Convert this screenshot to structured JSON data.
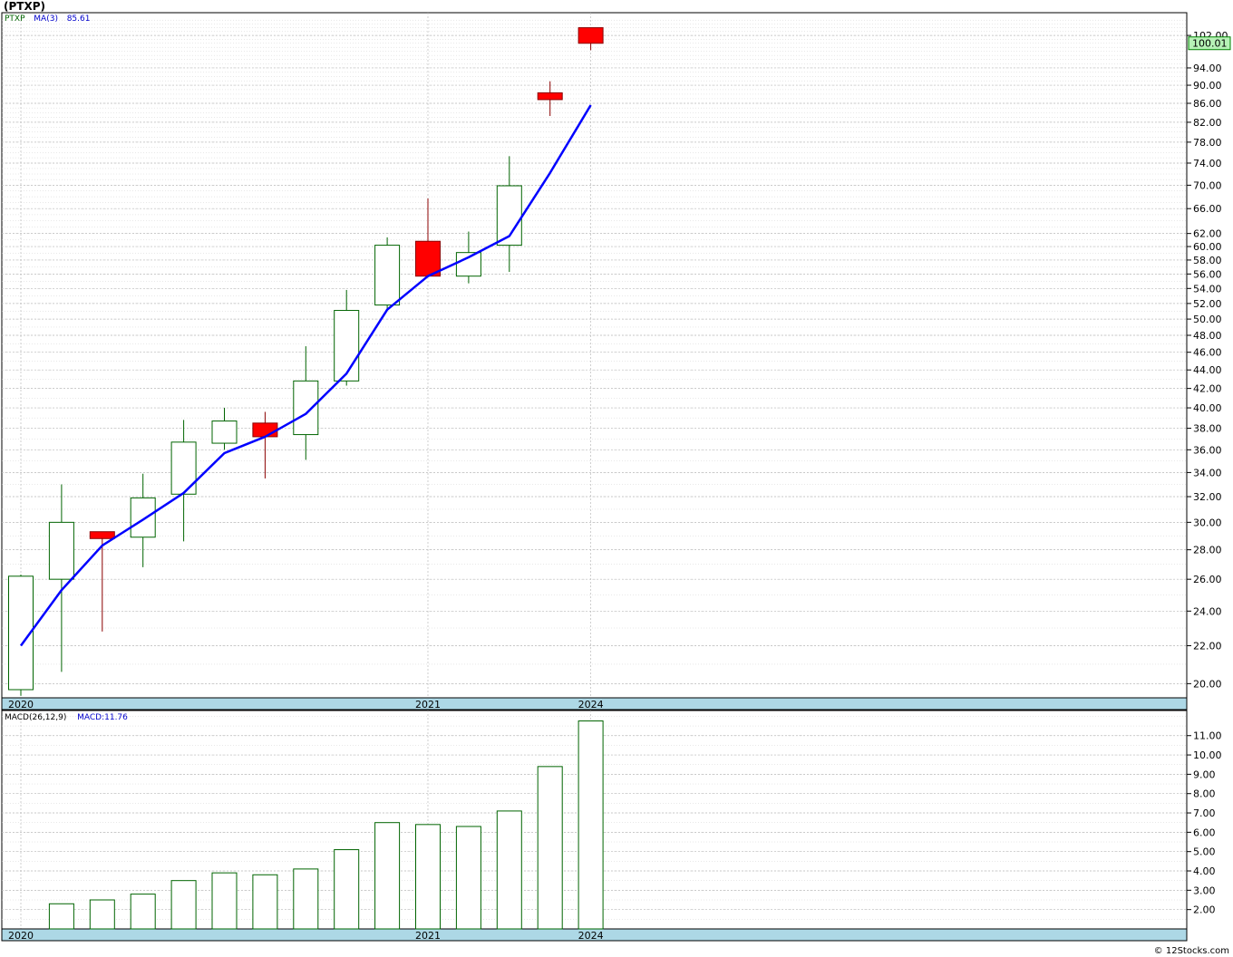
{
  "title": "(PTXP)",
  "copyright": "© 12Stocks.com",
  "colors": {
    "up_fill": "#ffffff",
    "up_stroke": "#006400",
    "down_fill": "#ff0000",
    "down_stroke": "#8b0000",
    "ma_line": "#0000ff",
    "axis_band": "#add8e6",
    "grid": "#bbbbbb",
    "last_price_bg": "#b6f2b6"
  },
  "chart_data": [
    {
      "type": "candlestick",
      "legend": {
        "symbol": "PTXP",
        "ma_label": "MA(3)",
        "ma_value": "85.61"
      },
      "last_price_label": "100.01",
      "scale": "log",
      "ylim": [
        19.3,
        108
      ],
      "y_ticks": [
        "20.00",
        "22.00",
        "24.00",
        "26.00",
        "28.00",
        "30.00",
        "32.00",
        "34.00",
        "36.00",
        "38.00",
        "40.00",
        "42.00",
        "44.00",
        "46.00",
        "48.00",
        "50.00",
        "52.00",
        "54.00",
        "56.00",
        "58.00",
        "60.00",
        "62.00",
        "66.00",
        "70.00",
        "74.00",
        "78.00",
        "82.00",
        "86.00",
        "90.00",
        "94.00",
        "102.00"
      ],
      "x_labels": [
        {
          "label": "2020",
          "index": 0
        },
        {
          "label": "2021",
          "index": 10
        },
        {
          "label": "2024",
          "index": 14
        }
      ],
      "candles": [
        {
          "open": 19.7,
          "high": 26.3,
          "low": 19.4,
          "close": 26.2
        },
        {
          "open": 26.0,
          "high": 33.0,
          "low": 20.6,
          "close": 30.0
        },
        {
          "open": 29.3,
          "high": 29.3,
          "low": 22.8,
          "close": 28.8
        },
        {
          "open": 28.9,
          "high": 33.9,
          "low": 26.8,
          "close": 31.9
        },
        {
          "open": 32.2,
          "high": 38.8,
          "low": 28.6,
          "close": 36.7
        },
        {
          "open": 36.6,
          "high": 40.0,
          "low": 36.0,
          "close": 38.7
        },
        {
          "open": 38.5,
          "high": 39.6,
          "low": 33.5,
          "close": 37.2
        },
        {
          "open": 37.4,
          "high": 46.7,
          "low": 35.1,
          "close": 42.8
        },
        {
          "open": 42.8,
          "high": 53.8,
          "low": 42.3,
          "close": 51.1
        },
        {
          "open": 51.8,
          "high": 61.4,
          "low": 51.3,
          "close": 60.2
        },
        {
          "open": 60.8,
          "high": 67.7,
          "low": 55.7,
          "close": 55.7
        },
        {
          "open": 55.7,
          "high": 62.3,
          "low": 54.7,
          "close": 59.1
        },
        {
          "open": 60.2,
          "high": 75.3,
          "low": 56.3,
          "close": 69.9
        },
        {
          "open": 88.3,
          "high": 90.9,
          "low": 83.3,
          "close": 86.8
        },
        {
          "open": 104.0,
          "high": 104.0,
          "low": 98.3,
          "close": 100.01
        }
      ],
      "ma": [
        22.0,
        25.3,
        28.3,
        30.2,
        32.3,
        35.7,
        37.2,
        39.4,
        43.6,
        51.2,
        55.7,
        58.4,
        61.6,
        72.2,
        85.61
      ]
    },
    {
      "type": "bar",
      "legend": {
        "indicator": "MACD(26,12,9)",
        "macd_label": "MACD:11.76"
      },
      "ylim": [
        1.0,
        12.3
      ],
      "y_ticks": [
        "2.00",
        "3.00",
        "4.00",
        "5.00",
        "6.00",
        "7.00",
        "8.00",
        "9.00",
        "10.00",
        "11.00"
      ],
      "x_labels": [
        {
          "label": "2020",
          "index": 0
        },
        {
          "label": "2021",
          "index": 10
        },
        {
          "label": "2024",
          "index": 14
        }
      ],
      "values": [
        1.0,
        2.3,
        2.5,
        2.8,
        3.5,
        3.9,
        3.8,
        4.1,
        5.1,
        6.5,
        6.4,
        6.3,
        7.1,
        9.4,
        11.76
      ]
    }
  ]
}
